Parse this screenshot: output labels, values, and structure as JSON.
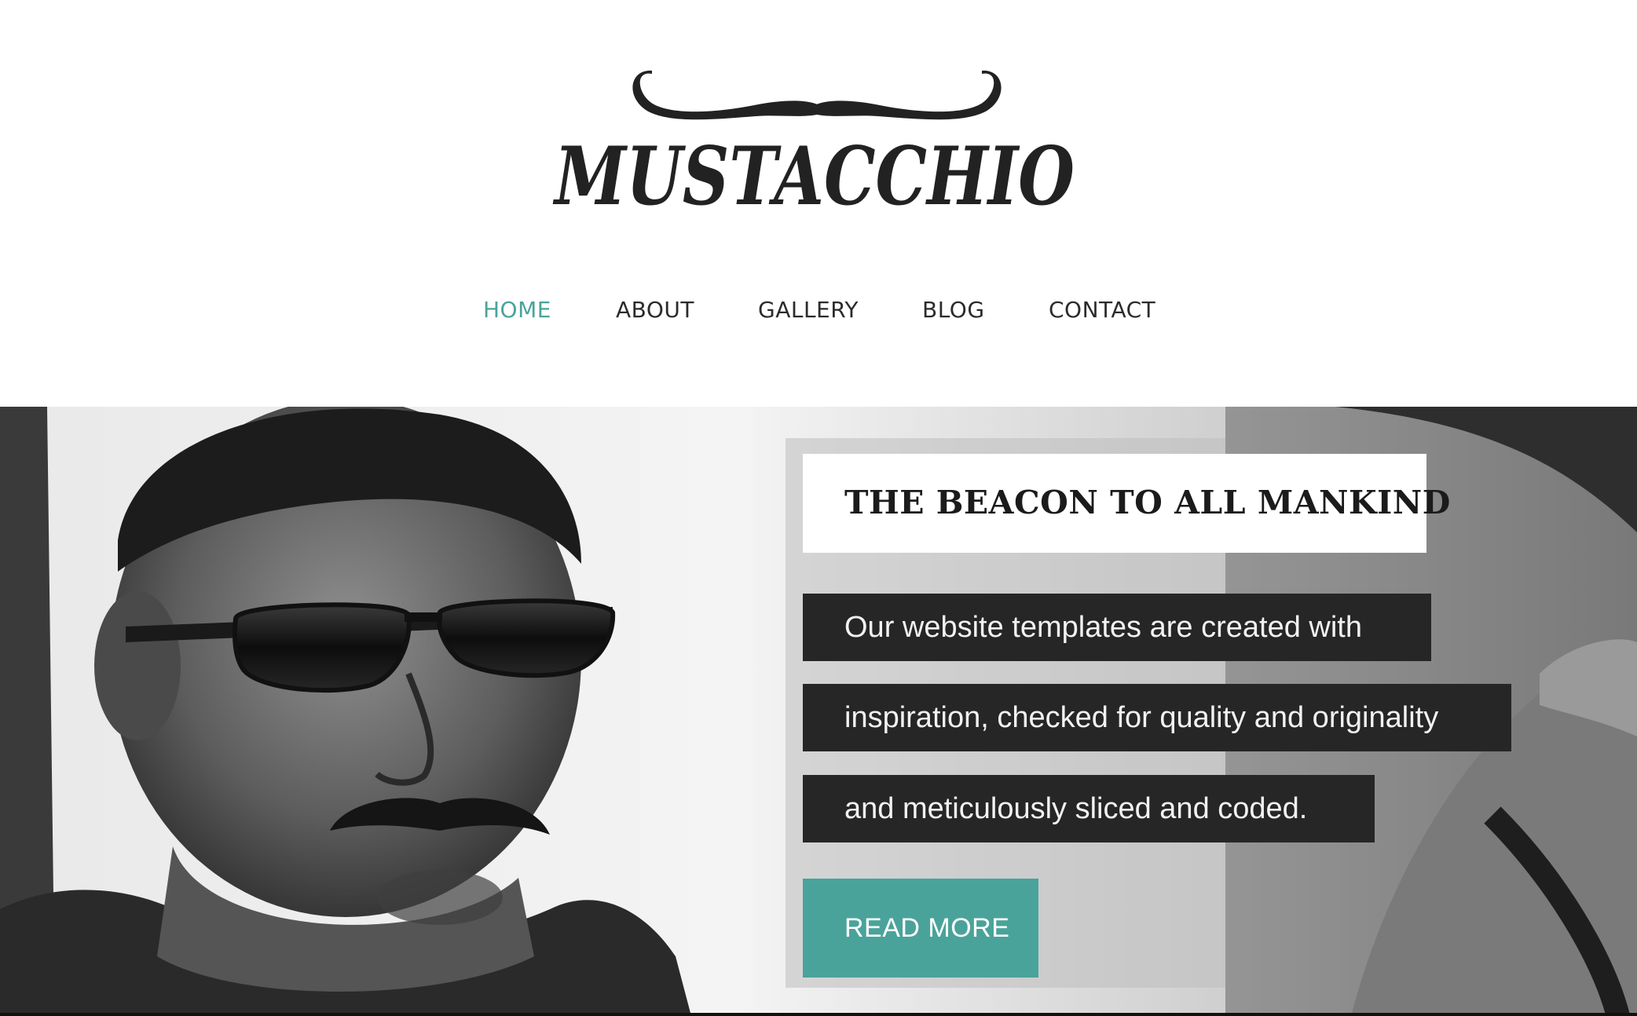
{
  "brand": {
    "name": "MUSTACCHIO",
    "logo_icon": "mustache-icon"
  },
  "nav": {
    "items": [
      {
        "label": "HOME",
        "active": true
      },
      {
        "label": "ABOUT",
        "active": false
      },
      {
        "label": "GALLERY",
        "active": false
      },
      {
        "label": "BLOG",
        "active": false
      },
      {
        "label": "CONTACT",
        "active": false
      }
    ]
  },
  "hero": {
    "image": "black-and-white photo of a man with sunglasses and a mustache in a car",
    "headline": "THE BEACON TO ALL MANKIND",
    "description_lines": [
      "Our website templates are created with",
      "inspiration, checked for quality and originality",
      "and meticulously sliced and coded."
    ],
    "button_label": "READ MORE"
  },
  "colors": {
    "accent": "#4aa39b",
    "nav_text": "#2b2b2b",
    "dark_box": "#262626",
    "logo": "#222222"
  }
}
